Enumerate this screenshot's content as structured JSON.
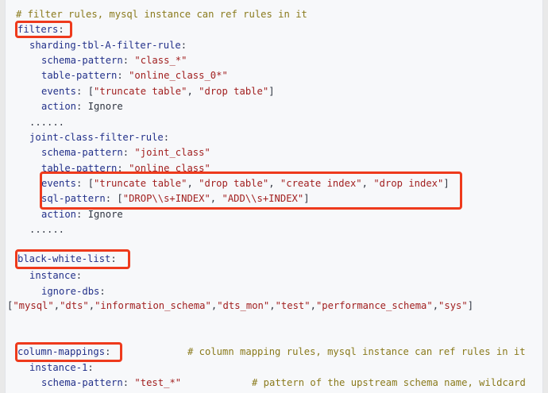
{
  "code": {
    "l1_comment": "# filter rules, mysql instance can ref rules in it",
    "l2_key": "filters",
    "l3_key": "sharding-tbl-A-filter-rule",
    "l4_key": "schema-pattern",
    "l4_val": "\"class_*\"",
    "l5_key": "table-pattern",
    "l5_val": "\"online_class_0*\"",
    "l6_key": "events",
    "l6_v1": "\"truncate table\"",
    "l6_v2": "\"drop table\"",
    "l7_key": "action",
    "l7_val": "Ignore",
    "l8_ellipsis": "......",
    "l9_key": "joint-class-filter-rule",
    "l10_key": "schema-pattern",
    "l10_val": "\"joint_class\"",
    "l11_key": "table-pattern",
    "l11_val": "\"online_class\"",
    "l12_key": "events",
    "l12_v1": "\"truncate table\"",
    "l12_v2": "\"drop table\"",
    "l12_v3": "\"create index\"",
    "l12_v4": "\"drop index\"",
    "l13_key": "sql-pattern",
    "l13_v1": "\"DROP\\\\s+INDEX\"",
    "l13_v2": "\"ADD\\\\s+INDEX\"",
    "l14_key": "action",
    "l14_val": "Ignore",
    "l15_ellipsis": "......",
    "l16_key": "black-white-list",
    "l17_key": "instance",
    "l18_key": "ignore-dbs",
    "l19_v1": "\"mysql\"",
    "l19_v2": "\"dts\"",
    "l19_v3": "\"information_schema\"",
    "l19_v4": "\"dts_mon\"",
    "l19_v5": "\"test\"",
    "l19_v6": "\"performance_schema\"",
    "l19_v7": "\"sys\"",
    "l20_key": "column-mappings",
    "l20_comment": "# column mapping rules, mysql instance can ref rules in it",
    "l21_key": "instance-1",
    "l22_key": "schema-pattern",
    "l22_val": "\"test_*\"",
    "l22_comment": "# pattern of the upstream schema name, wildcard"
  },
  "annotations": {
    "highlight_color": "#ee3a1c"
  }
}
